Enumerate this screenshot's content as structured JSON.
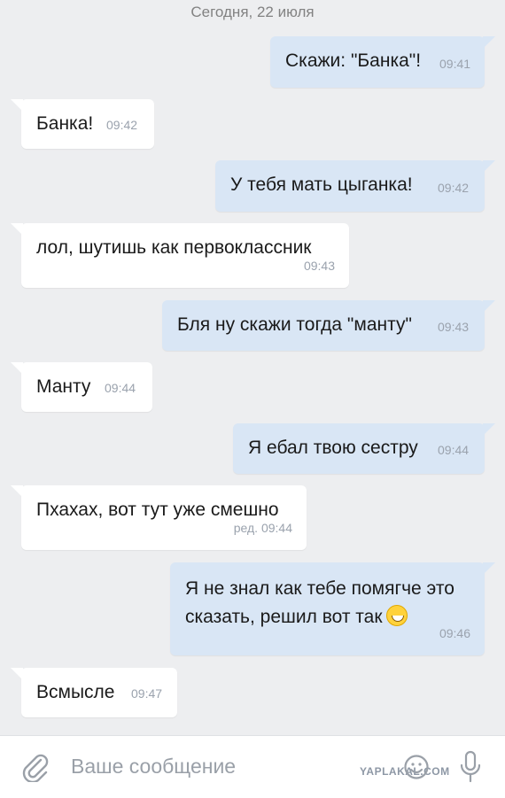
{
  "chat": {
    "date_header": "Сегодня, 22 июля",
    "messages": [
      {
        "direction": "out",
        "text": "Скажи: \"Банка\"!",
        "time": "09:41"
      },
      {
        "direction": "in",
        "text": "Банка!",
        "time": "09:42"
      },
      {
        "direction": "out",
        "text": "У тебя мать цыганка!",
        "time": "09:42"
      },
      {
        "direction": "in",
        "text": "лол, шутишь как первоклассник",
        "time": "09:43"
      },
      {
        "direction": "out",
        "text": "Бля ну скажи тогда \"манту\"",
        "time": "09:43"
      },
      {
        "direction": "in",
        "text": "Манту",
        "time": "09:44"
      },
      {
        "direction": "out",
        "text": "Я ебал твою сестру",
        "time": "09:44"
      },
      {
        "direction": "in",
        "text": "Пхахах, вот тут уже смешно",
        "time": "ред. 09:44"
      },
      {
        "direction": "out",
        "text_line1": "Я не знал как тебе помягче это",
        "text_line2": "сказать, решил вот так",
        "emoji": "grinning-sweat-emoji",
        "time": "09:46"
      },
      {
        "direction": "in",
        "text": "Всмысле",
        "time": "09:47"
      }
    ]
  },
  "composer": {
    "placeholder": "Ваше сообщение",
    "attach_icon": "paperclip-icon",
    "sticker_icon": "sticker-icon",
    "mic_icon": "microphone-icon"
  },
  "watermark": "YAPLAKAL.COM",
  "colors": {
    "background": "#edeef0",
    "incoming": "#ffffff",
    "outgoing": "#d9e6f5",
    "time": "#9aa2ad"
  }
}
